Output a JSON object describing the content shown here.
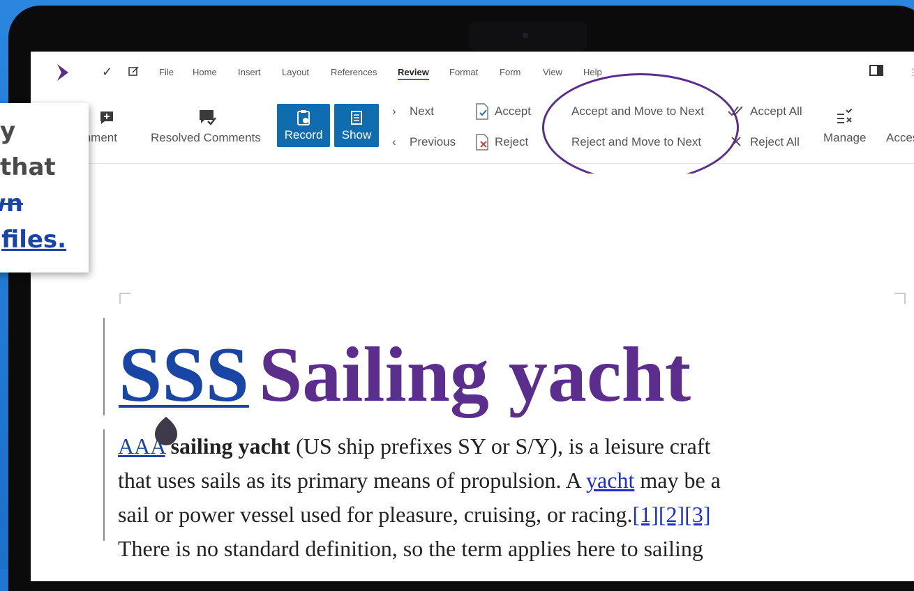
{
  "callout": {
    "line1": "y",
    "line2": "that",
    "line3_deleted": "own",
    "line4_inserted": "files."
  },
  "menubar": {
    "quick_actions": [
      "check-icon",
      "edit-icon"
    ],
    "items": [
      "File",
      "Home",
      "Insert",
      "Layout",
      "References",
      "Review",
      "Format",
      "Form",
      "View",
      "Help"
    ],
    "active": "Review"
  },
  "ribbon": {
    "comment_label": "mment",
    "resolved_comments_label": "Resolved Comments",
    "record_label": "Record",
    "show_label": "Show",
    "next_label": "Next",
    "previous_label": "Previous",
    "accept_label": "Accept",
    "reject_label": "Reject",
    "accept_move_next_label": "Accept and Move to Next",
    "reject_move_next_label": "Reject and Move to Next",
    "accept_all_label": "Accept All",
    "reject_all_label": "Reject All",
    "manage_label": "Manage",
    "access_label": "Acces"
  },
  "document": {
    "title_inserted": "SSS",
    "title": "Sailing yacht",
    "para_line1_inserted": "AAA",
    "para_line1_bold": "sailing yacht",
    "para_line1_rest": " (US ship prefixes SY or S/Y), is a leisure craft",
    "para_line2_start": "that uses sails as its primary means of propulsion. A ",
    "para_line2_link": "yacht",
    "para_line2_end": " may be a",
    "para_line3_start": "sail or power vessel used for pleasure, cruising, or racing.",
    "para_line3_refs": "[1][2][3]",
    "para_line4": "There is no standard definition, so the term applies here to sailing"
  },
  "colors": {
    "accent_purple": "#5b2d8c",
    "insert_blue": "#1946a5",
    "button_blue": "#0f6cae"
  }
}
